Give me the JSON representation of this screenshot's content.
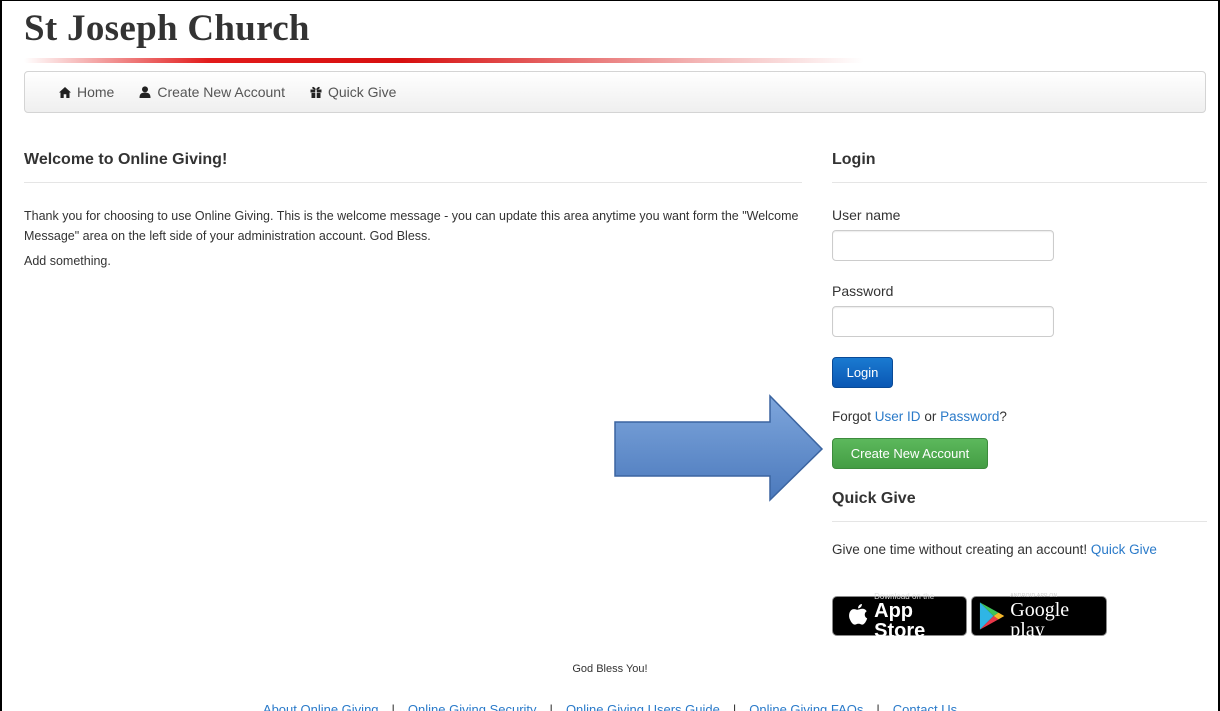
{
  "header": {
    "church_name": "St Joseph Church"
  },
  "nav": {
    "items": [
      {
        "label": "Home",
        "icon": "home-icon"
      },
      {
        "label": "Create New Account",
        "icon": "user-icon"
      },
      {
        "label": "Quick Give",
        "icon": "gift-icon"
      }
    ]
  },
  "welcome": {
    "heading": "Welcome to Online Giving!",
    "message": "Thank you for choosing to use Online Giving. This is the welcome message - you can update this area anytime you want form the \"Welcome Message\" area on the left side of your administration account. God Bless.",
    "extra": "Add something."
  },
  "login": {
    "heading": "Login",
    "username_label": "User name",
    "username_value": "",
    "password_label": "Password",
    "password_value": "",
    "login_button": "Login",
    "forgot_prefix": "Forgot",
    "user_id_link": "User ID",
    "or_text": "or",
    "password_link": "Password",
    "question_mark": "?",
    "create_button": "Create New Account"
  },
  "quick_give": {
    "heading": "Quick Give",
    "text": "Give one time without creating an account!",
    "link": "Quick Give"
  },
  "badges": {
    "apple_small": "Download on the",
    "apple_big": "App Store",
    "google_small": "ANDROID APP ON",
    "google_big": "Google play"
  },
  "footer": {
    "message": "God Bless You!",
    "links": [
      "About Online Giving",
      "Online Giving Security",
      "Online Giving Users Guide",
      "Online Giving FAQs",
      "Contact Us"
    ],
    "separator": "|"
  },
  "colors": {
    "link": "#2a7ac9",
    "login_button": "#0a57b4",
    "create_button": "#5cb85c",
    "arrow_fill": "#4f81bd",
    "title_underline": "#d70f0f"
  }
}
